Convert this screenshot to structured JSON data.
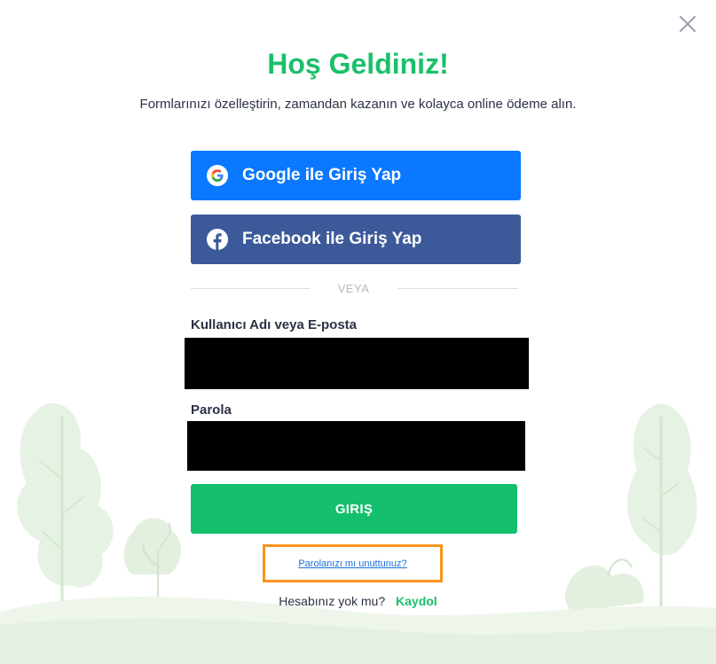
{
  "modal": {
    "title": "Hoş Geldiniz!",
    "subtitle": "Formlarınızı özelleştirin, zamandan kazanın ve kolayca online ödeme alın."
  },
  "social": {
    "google_label": "Google ile Giriş Yap",
    "facebook_label": "Facebook ile Giriş Yap",
    "google_icon": "google-icon",
    "facebook_icon": "facebook-icon"
  },
  "divider_text": "VEYA",
  "form": {
    "username_label": "Kullanıcı Adı veya E-posta",
    "username_value": "",
    "password_label": "Parola",
    "password_value": "",
    "login_label": "GIRIŞ"
  },
  "links": {
    "forgot_password": "Parolanızı mı unuttunuz?",
    "no_account": "Hesabınız yok mu?",
    "signup": "Kaydol"
  },
  "colors": {
    "accent_green": "#1bbf6a",
    "google_blue": "#0a78ff",
    "facebook_blue": "#3c5a9a",
    "highlight_orange": "#f7931e",
    "link_blue": "#1a6fd8"
  }
}
